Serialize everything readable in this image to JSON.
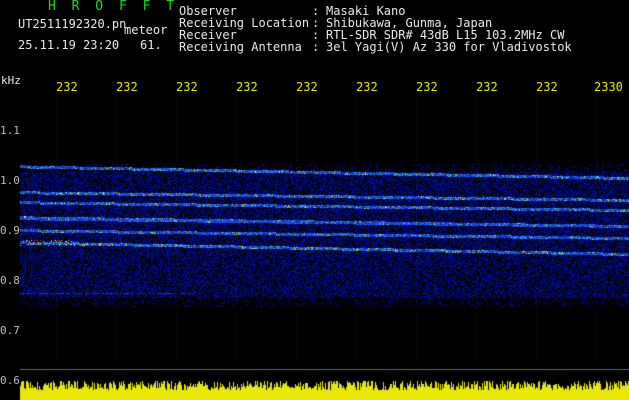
{
  "header": {
    "title": "H R O F F T",
    "filename": "UT2511192320.pn",
    "meteor_label": "meteor",
    "datetime": "25.11.19 23:20",
    "count": "61.",
    "info": [
      {
        "label": "Observer",
        "value": "Masaki Kano"
      },
      {
        "label": "Receiving Location",
        "value": "Shibukawa, Gunma, Japan"
      },
      {
        "label": "Receiver",
        "value": "RTL-SDR SDR# 43dB L15 103.2MHz CW"
      },
      {
        "label": "Receiving Antenna",
        "value": "3el Yagi(V) Az 330 for Vladivostok"
      }
    ],
    "separator": ":"
  },
  "axis": {
    "unit": "kHz",
    "time_ticks": [
      "232",
      "232",
      "232",
      "232",
      "232",
      "232",
      "232",
      "232",
      "232",
      "2330"
    ],
    "freq_ticks": [
      "1.1",
      "1.0",
      "0.9",
      "0.8",
      "0.7",
      "0.6"
    ]
  },
  "colors": {
    "background": "#000000",
    "title": "#21d321",
    "text": "#e8e8e8",
    "ticks": "#e8e800",
    "noise_floor": "#e8e800"
  }
}
